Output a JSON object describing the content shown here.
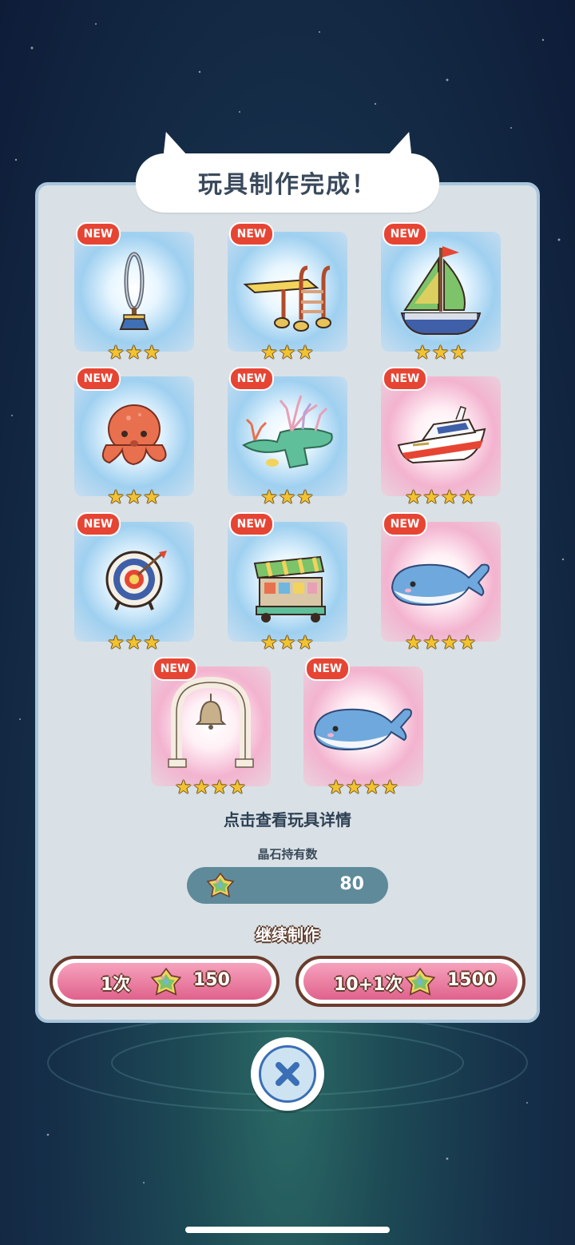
{
  "dialog": {
    "title": "玩具制作完成！",
    "hint": "点击查看玩具详情",
    "held_label": "晶石持有数",
    "held_value": "80",
    "continue_label": "继续制作"
  },
  "badge_text": "NEW",
  "items": [
    {
      "name": "ring-hoop-toy",
      "rarity": 3,
      "glow": "blue"
    },
    {
      "name": "diving-platform-toy",
      "rarity": 3,
      "glow": "blue"
    },
    {
      "name": "sailboat-toy",
      "rarity": 3,
      "glow": "blue"
    },
    {
      "name": "octopus-toy",
      "rarity": 3,
      "glow": "blue"
    },
    {
      "name": "coral-reef-toy",
      "rarity": 3,
      "glow": "blue"
    },
    {
      "name": "yacht-toy",
      "rarity": 4,
      "glow": "pink"
    },
    {
      "name": "target-board-toy",
      "rarity": 3,
      "glow": "blue"
    },
    {
      "name": "market-stall-toy",
      "rarity": 3,
      "glow": "blue"
    },
    {
      "name": "whale-plush-toy",
      "rarity": 4,
      "glow": "pink"
    },
    {
      "name": "bell-arch-toy",
      "rarity": 4,
      "glow": "pink"
    },
    {
      "name": "whale-plush-toy",
      "rarity": 4,
      "glow": "pink"
    }
  ],
  "buttons": {
    "single": {
      "count_label": "1次",
      "cost": "150"
    },
    "multi": {
      "count_label": "10+1次",
      "cost": "1500"
    }
  },
  "colors": {
    "panel": "#d9e1e6",
    "button_pink": "#e0628c",
    "badge_red": "#e64534",
    "star_gold": "#f2c230"
  }
}
